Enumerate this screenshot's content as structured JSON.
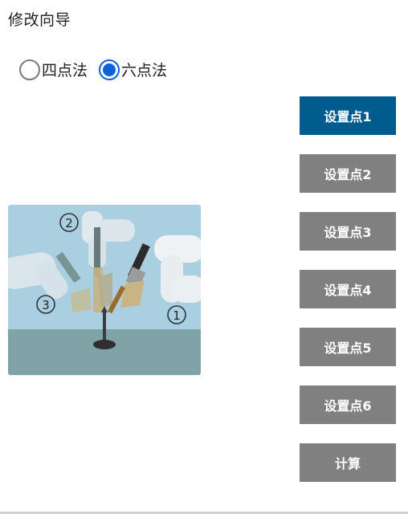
{
  "header": {
    "title": "修改向导"
  },
  "method": {
    "options": [
      {
        "label": "四点法",
        "checked": false
      },
      {
        "label": "六点法",
        "checked": true
      }
    ]
  },
  "buttons": {
    "p1": "设置点1",
    "p2": "设置点2",
    "p3": "设置点3",
    "p4": "设置点4",
    "p5": "设置点5",
    "p6": "设置点6",
    "calc": "计算"
  },
  "illustration": {
    "markers": [
      "2",
      "3",
      "1"
    ]
  },
  "colors": {
    "active_button": "#005b8f",
    "inactive_button": "#808080",
    "radio_accent": "#0a63d8"
  }
}
